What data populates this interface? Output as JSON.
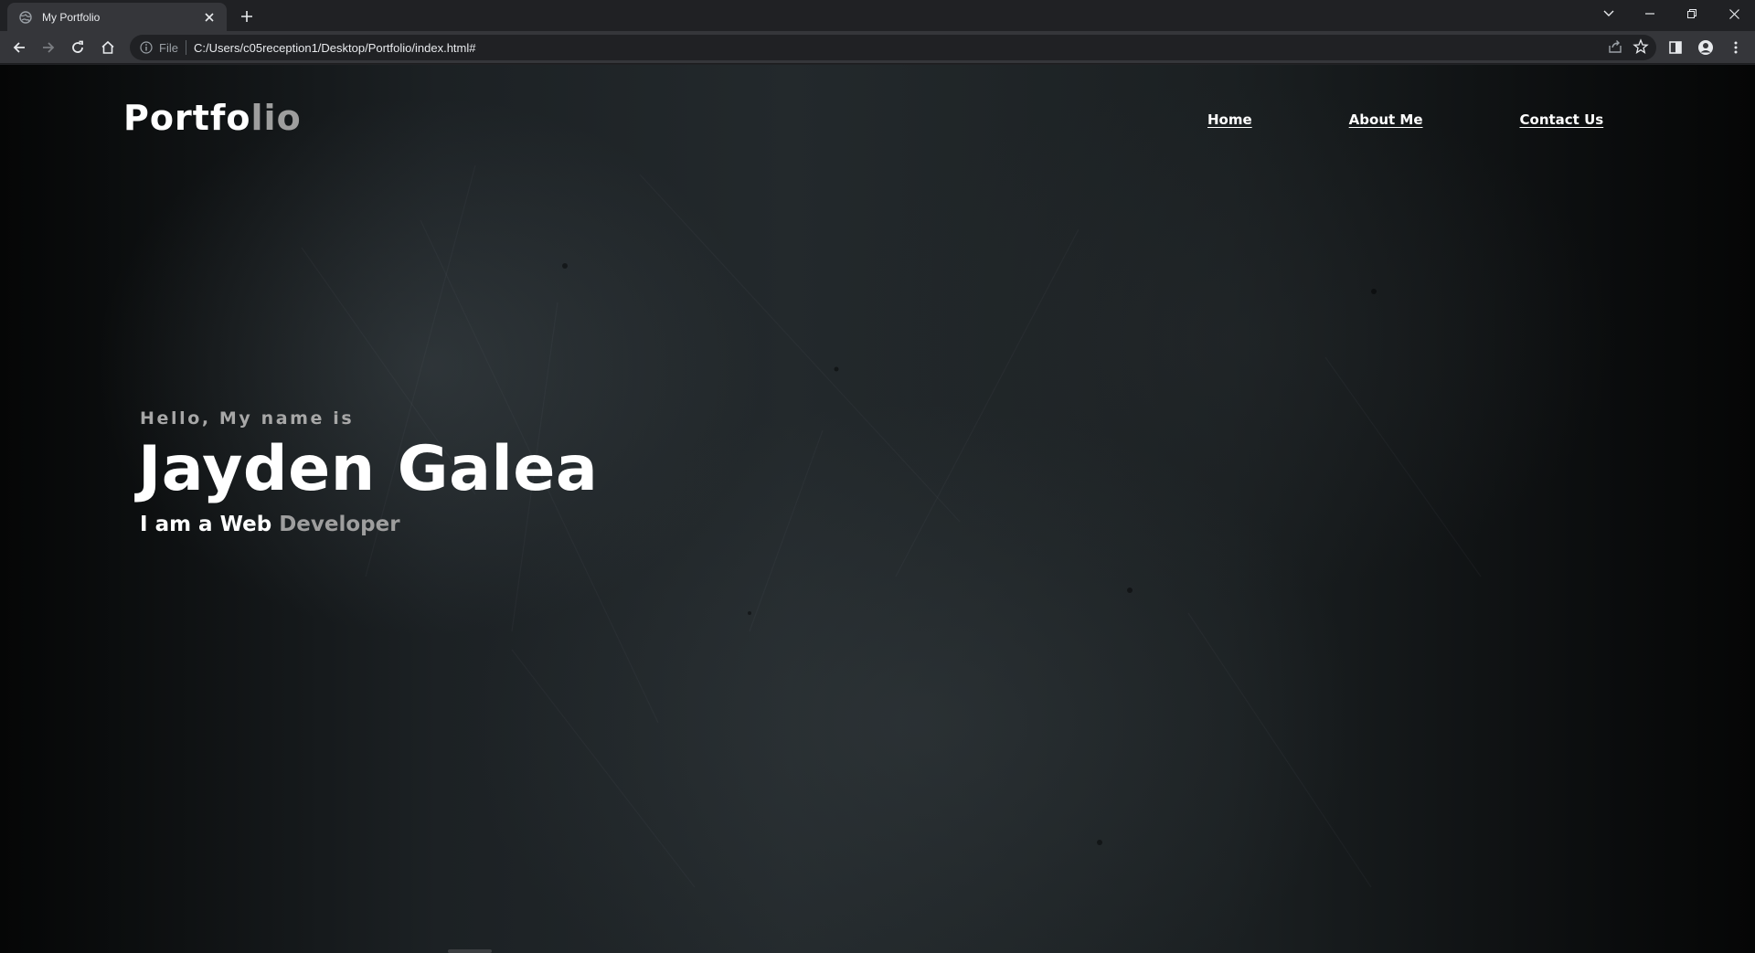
{
  "browser": {
    "tab": {
      "title": "My Portfolio",
      "favicon": "globe-icon"
    },
    "address_bar": {
      "scheme_label": "File",
      "url": "C:/Users/c05reception1/Desktop/Portfolio/index.html#"
    }
  },
  "page": {
    "logo": {
      "main": "Portfo",
      "accent": "lio"
    },
    "nav": {
      "home": "Home",
      "about": "About Me",
      "contact": "Contact Us"
    },
    "hero": {
      "greeting": "Hello, My name is",
      "name": "Jayden Galea",
      "role_prefix": "I am a Web",
      "role_accent": "Developer"
    }
  },
  "colors": {
    "text_primary": "#ffffff",
    "text_accent": "#9e9e9e",
    "chrome_bg": "#202124",
    "toolbar_bg": "#35363a"
  }
}
